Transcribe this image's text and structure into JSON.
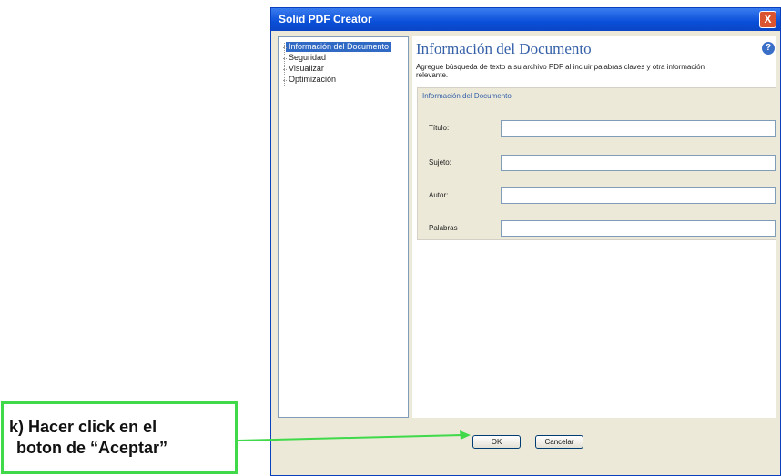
{
  "window": {
    "title": "Solid PDF Creator",
    "close_label": "X"
  },
  "nav": {
    "items": [
      {
        "label": "Información del Documento",
        "selected": true
      },
      {
        "label": "Seguridad",
        "selected": false
      },
      {
        "label": "Visualizar",
        "selected": false
      },
      {
        "label": "Optimización",
        "selected": false
      }
    ]
  },
  "content": {
    "title": "Información del Documento",
    "help_label": "?",
    "description": "Agregue búsqueda de texto a su archivo PDF al incluir palabras claves y otra información relevante.",
    "group_title": "Información del Documento",
    "fields": [
      {
        "label": "Título:",
        "value": ""
      },
      {
        "label": "Sujeto:",
        "value": ""
      },
      {
        "label": "Autor:",
        "value": ""
      },
      {
        "label": "Palabras",
        "value": ""
      }
    ]
  },
  "buttons": {
    "ok": "OK",
    "cancel": "Cancelar"
  },
  "annotation": {
    "line1": "k) Hacer click en el",
    "line2": "boton de “Aceptar”",
    "color": "#3fd94a"
  },
  "colors": {
    "titlebar": "#0a4fd8",
    "selection": "#316ac5",
    "heading": "#3560a8"
  }
}
